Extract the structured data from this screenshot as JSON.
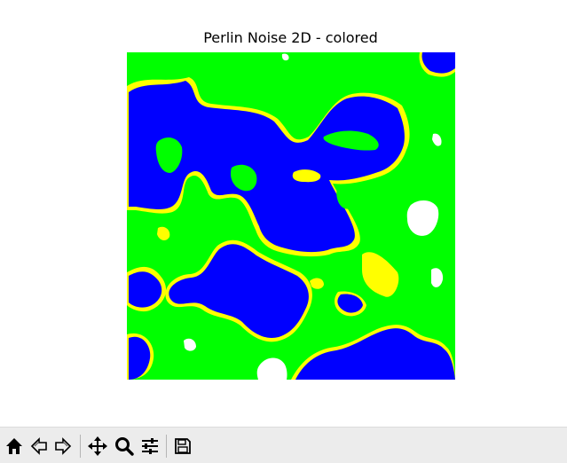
{
  "figure": {
    "title": "Perlin Noise 2D - colored"
  },
  "image": {
    "colormap": {
      "water": "#0000ff",
      "sand": "#ffff00",
      "grass": "#00ff00",
      "snow": "#ffffff"
    }
  },
  "toolbar": {
    "buttons": [
      {
        "icon": "home-icon"
      },
      {
        "icon": "back-arrow-icon"
      },
      {
        "icon": "forward-arrow-icon"
      },
      {
        "icon": "pan-move-icon"
      },
      {
        "icon": "zoom-magnifier-icon"
      },
      {
        "icon": "configure-subplots-icon"
      },
      {
        "icon": "save-floppy-icon"
      }
    ]
  }
}
